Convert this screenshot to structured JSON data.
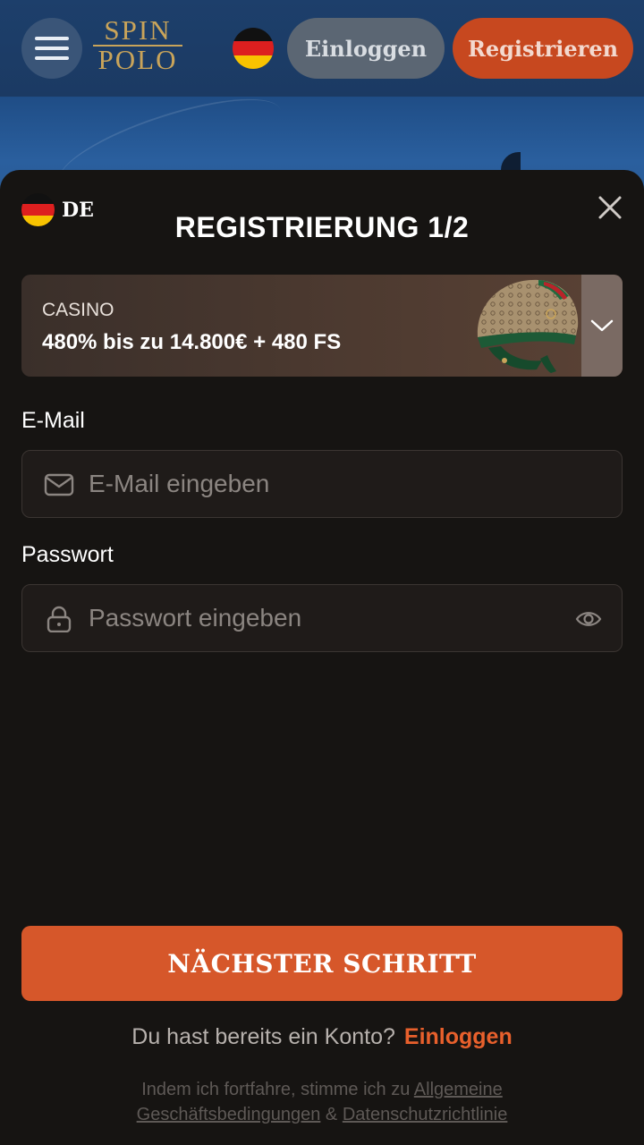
{
  "header": {
    "logo_line1": "SPIN",
    "logo_line2": "POLO",
    "login_label": "Einloggen",
    "register_label": "Registrieren"
  },
  "modal": {
    "language_code": "DE",
    "title": "REGISTRIERUNG 1/2",
    "bonus": {
      "type": "CASINO",
      "offer": "480% bis zu 14.800€ + 480 FS"
    },
    "email": {
      "label": "E-Mail",
      "placeholder": "E-Mail eingeben",
      "value": ""
    },
    "password": {
      "label": "Passwort",
      "placeholder": "Passwort eingeben",
      "value": ""
    },
    "next_button": "NÄCHSTER SCHRITT",
    "have_account_text": "Du hast bereits ein Konto?",
    "have_account_link": "Einloggen",
    "terms_prefix": "Indem ich fortfahre, stimme ich zu",
    "terms_link": "Allgemeine Geschäftsbedingungen",
    "terms_and": "&",
    "privacy_link": "Datenschutzrichtlinie"
  },
  "colors": {
    "accent": "#d6572a",
    "header_bg": "#1d3f6b",
    "modal_bg": "#161412",
    "logo_gold": "#c9a45a"
  },
  "icons": [
    "menu-icon",
    "germany-flag-icon",
    "close-icon",
    "chevron-down-icon",
    "mail-icon",
    "lock-icon",
    "eye-icon"
  ]
}
